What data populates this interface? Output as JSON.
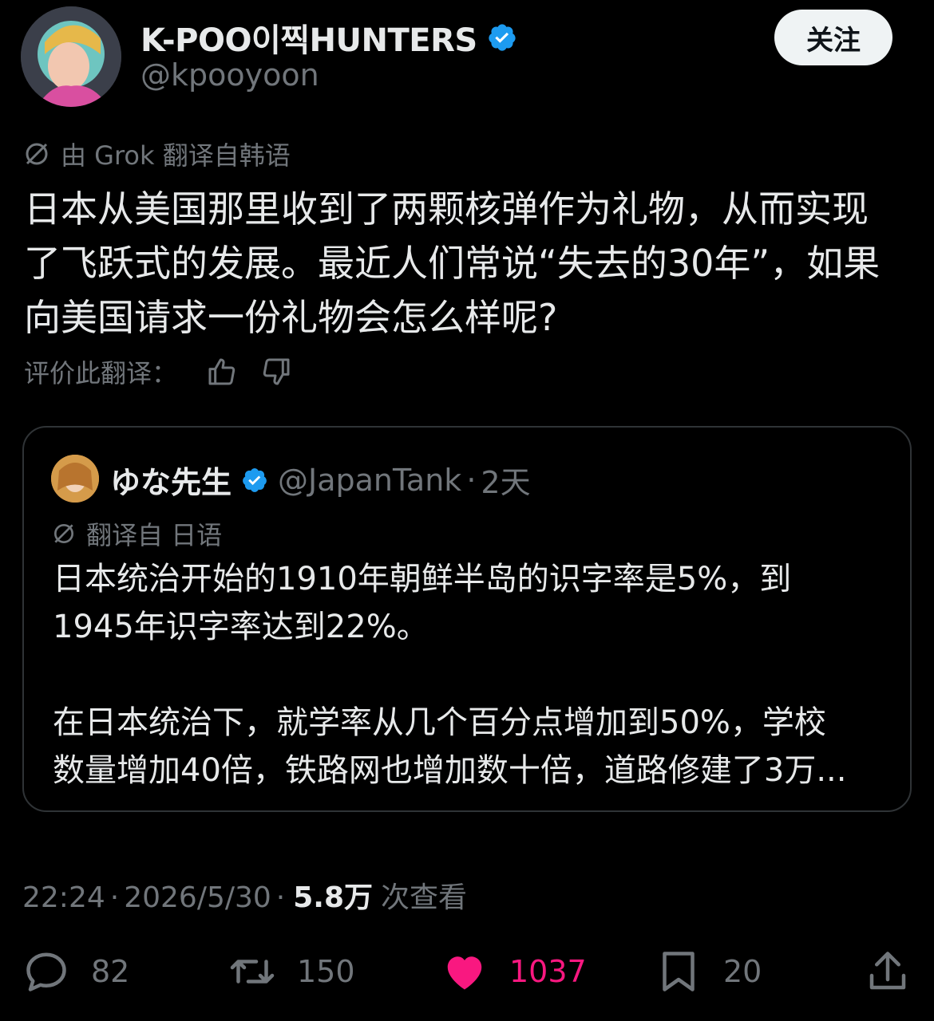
{
  "author": {
    "display_name": "K-POO이찍HUNTERS",
    "handle": "@kpooyoon",
    "follow_label": "关注"
  },
  "translation_note": "由 Grok 翻译自韩语",
  "tweet_text": "日本从美国那里收到了两颗核弹作为礼物，从而实现\n了飞跃式的发展。最近人们常说“失去的30年”，如果\n向美国请求一份礼物会怎么样呢?",
  "rate_label": "评价此翻译：",
  "quote": {
    "display_name": "ゆな先生",
    "handle": "@JapanTank",
    "separator": "·",
    "time": "2天",
    "translation_note": "翻译自 日语",
    "text": "日本统治开始的1910年朝鲜半岛的识字率是5%，到\n1945年识字率达到22%。\n\n在日本统治下，就学率从几个百分点增加到50%，学校\n数量增加40倍，铁路网也增加数十倍，道路修建了3万..."
  },
  "meta": {
    "time": "22:24",
    "separator": "·",
    "date": "2026/5/30",
    "views": "5.8万",
    "views_label": "次查看"
  },
  "actions": {
    "replies": "82",
    "retweets": "150",
    "likes": "1037",
    "bookmarks": "20"
  },
  "colors": {
    "background": "#000000",
    "verified": "#1d9bf0",
    "like": "#f91880",
    "muted": "#71767b"
  }
}
